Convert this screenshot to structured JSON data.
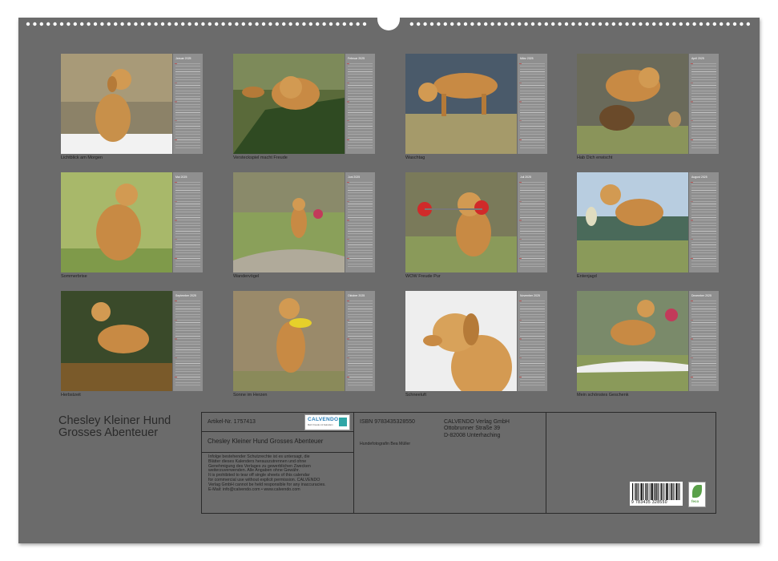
{
  "calendar": {
    "title_line1": "Chesley Kleiner Hund",
    "title_line2": "Grosses Abenteuer",
    "colors": {
      "sheet": "#6b6b6b",
      "calendar_strip": "#8f8f8f",
      "sunday_mark": "#c23a3a"
    }
  },
  "months": [
    {
      "name": "Januar 2025",
      "caption": "Lichtblick am Morgen"
    },
    {
      "name": "Februar 2025",
      "caption": "Versteckspiel macht Freude"
    },
    {
      "name": "März 2025",
      "caption": "Waschtag"
    },
    {
      "name": "April 2025",
      "caption": "Hab Dich erwischt"
    },
    {
      "name": "Mai 2025",
      "caption": "Sommerbrise"
    },
    {
      "name": "Juni 2025",
      "caption": "Wandervögel"
    },
    {
      "name": "Juli 2025",
      "caption": "WOW Freude Pur"
    },
    {
      "name": "August 2025",
      "caption": "Entenjagd"
    },
    {
      "name": "September 2025",
      "caption": "Herbstzeit"
    },
    {
      "name": "Oktober 2025",
      "caption": "Sonne im Herzen"
    },
    {
      "name": "November 2025",
      "caption": "Schneeluft"
    },
    {
      "name": "Dezember 2025",
      "caption": "Mein schönstes Geschenk"
    }
  ],
  "info": {
    "article_no": "Artikel-Nr. 1757413",
    "product_title": "Chesley Kleiner Hund Grosses Abenteuer",
    "isbn": "ISBN 9783435328550",
    "photographer": "Hundefotografin Bea Müller",
    "publisher_name": "CALVENDO Verlag GmbH",
    "publisher_street": "Ottobrunner Straße 39",
    "publisher_city": "D-82008 Unterhaching",
    "legal": [
      "Infolge bestehender Schutzrechte ist es untersagt, die",
      "Blätter dieses Kalenders herauszutrennen und ohne",
      "Genehmigung des Verlages zu gewerblichen Zwecken",
      "weiterzuverwenden. Alle Angaben ohne Gewähr.",
      "It is prohibited to tear off single sheets of this calendar",
      "for commercial use without explicit permission. CALVENDO",
      "Verlag GmbH cannot be held responsible for any inaccuracies.",
      "E-Mail: info@calvendo.com • www.calvendo.com"
    ],
    "logo_text": "CALVENDO",
    "logo_sub": "Mehr Freude mit Kalendern",
    "barcode_number": "9 783435 328550",
    "feco_label": "feco"
  }
}
